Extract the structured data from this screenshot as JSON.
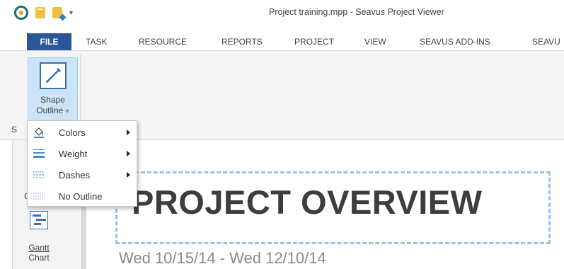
{
  "window": {
    "title": "Project training.mpp - Seavus Project Viewer"
  },
  "quick_access": {
    "more_label": "▾"
  },
  "tabs": [
    {
      "label": "FILE"
    },
    {
      "label": "TASK"
    },
    {
      "label": "RESOURCE"
    },
    {
      "label": "REPORTS"
    },
    {
      "label": "PROJECT"
    },
    {
      "label": "VIEW"
    },
    {
      "label": "SEAVUS ADD-INS"
    },
    {
      "label": "SEAVU"
    }
  ],
  "ribbon": {
    "shape_outline": {
      "label_line1": "Shape",
      "label_line2": "Outline",
      "caret": "▾"
    },
    "group_label": "S"
  },
  "menu": {
    "items": [
      {
        "label": "Colors",
        "icon": "paint-bucket-icon"
      },
      {
        "label": "Weight",
        "icon": "line-weight-icon"
      },
      {
        "label": "Dashes",
        "icon": "dashes-icon"
      },
      {
        "label": "No Outline",
        "icon": "no-outline-icon"
      }
    ]
  },
  "left_pane": {
    "calendar_label": "C",
    "gantt_label_line1": "Gantt",
    "gantt_label_line2": "Chart"
  },
  "report": {
    "title": "PROJECT OVERVIEW",
    "dates": "Wed 10/15/14 - Wed 12/10/14"
  },
  "colors": {
    "file_tab": "#2b579a",
    "selected_button": "#cce4f7",
    "textbox_border": "#9cc2e8"
  }
}
